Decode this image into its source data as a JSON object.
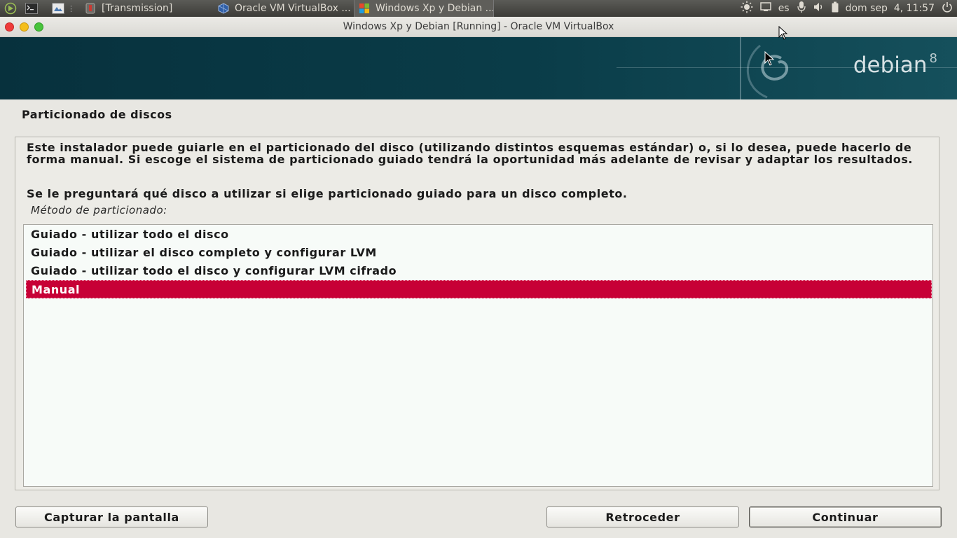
{
  "panel": {
    "tasks": [
      {
        "label": "[Transmission]",
        "icon": "transmission-icon"
      },
      {
        "label": "Oracle VM VirtualBox ...",
        "icon": "virtualbox-icon"
      },
      {
        "label": "Windows Xp y Debian ...",
        "icon": "windows-icon"
      }
    ],
    "tray": {
      "language": "es",
      "clock": "dom sep  4, 11:57"
    }
  },
  "window": {
    "title": "Windows Xp y Debian [Running] - Oracle VM VirtualBox"
  },
  "banner": {
    "logo_text": "debian",
    "logo_version": "8"
  },
  "installer": {
    "heading": "Particionado de discos",
    "description": "Este instalador puede guiarle en el particionado del disco (utilizando distintos esquemas estándar) o, si lo desea, puede hacerlo de forma manual. Si escoge el sistema de particionado guiado tendrá la oportunidad más adelante de revisar y adaptar los resultados.",
    "description2": "Se le preguntará qué disco a utilizar si elige particionado guiado para un disco completo.",
    "method_label": "Método de particionado:",
    "options": [
      "Guiado - utilizar todo el disco",
      "Guiado - utilizar el disco completo y configurar LVM",
      "Guiado - utilizar todo el disco y configurar LVM cifrado",
      "Manual"
    ],
    "selected_index": 3,
    "selection_color": "#c70036"
  },
  "buttons": {
    "screenshot": "Capturar la pantalla",
    "back": "Retroceder",
    "continue": "Continuar"
  }
}
